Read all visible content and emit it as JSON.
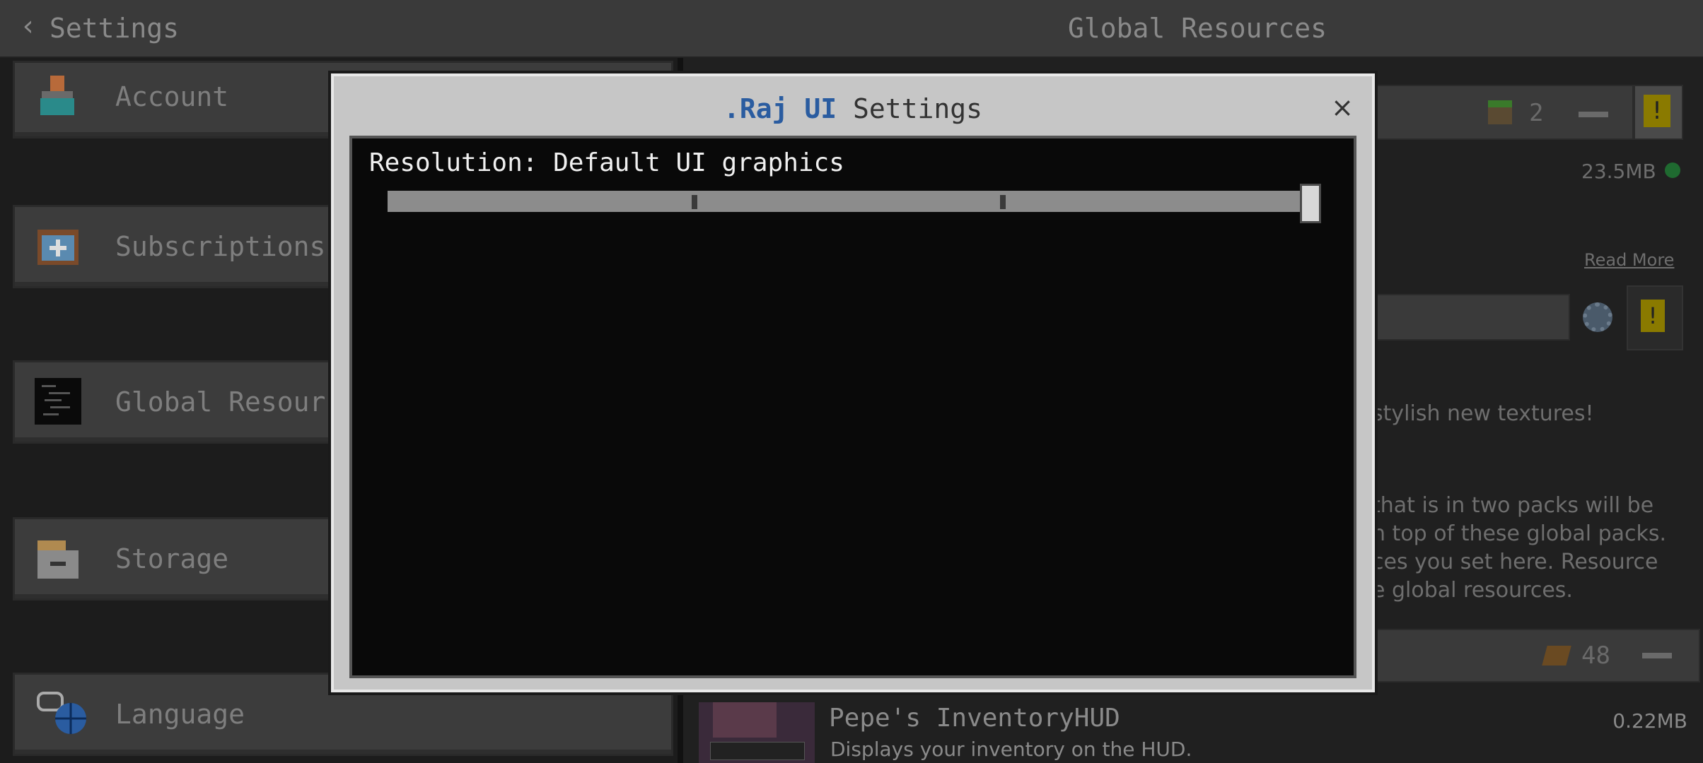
{
  "header": {
    "back_label": "Settings",
    "title": "Global Resources"
  },
  "sidebar": {
    "items": [
      {
        "label": "Account",
        "icon": "account-icon"
      },
      {
        "label": "Subscriptions",
        "icon": "subscriptions-icon"
      },
      {
        "label": "Global Resources",
        "icon": "global-resources-icon"
      },
      {
        "label": "Storage",
        "icon": "storage-icon"
      },
      {
        "label": "Language",
        "icon": "language-icon"
      }
    ]
  },
  "right": {
    "active_pack": {
      "count": "2",
      "size": "23.5MB",
      "read_more": "Read More"
    },
    "desc1": "stylish new textures!",
    "desc2_lines": [
      "that is in two packs will be",
      "n top of these global packs.",
      "ces you set here. Resource",
      "e global resources."
    ],
    "inventory_count": "48",
    "pack_item": {
      "name": "Pepe's InventoryHUD",
      "description": "Displays your inventory on the HUD.",
      "size": "0.22MB"
    }
  },
  "modal": {
    "brand": ".Raj UI",
    "title_suffix": "Settings",
    "close": "×",
    "resolution_label": "Resolution: Default UI graphics",
    "slider": {
      "steps": 4,
      "selected_index": 3
    }
  },
  "colors": {
    "brand_blue": "#2a5ca0",
    "status_green": "#22aa44",
    "warning_yellow": "#c8a800"
  }
}
